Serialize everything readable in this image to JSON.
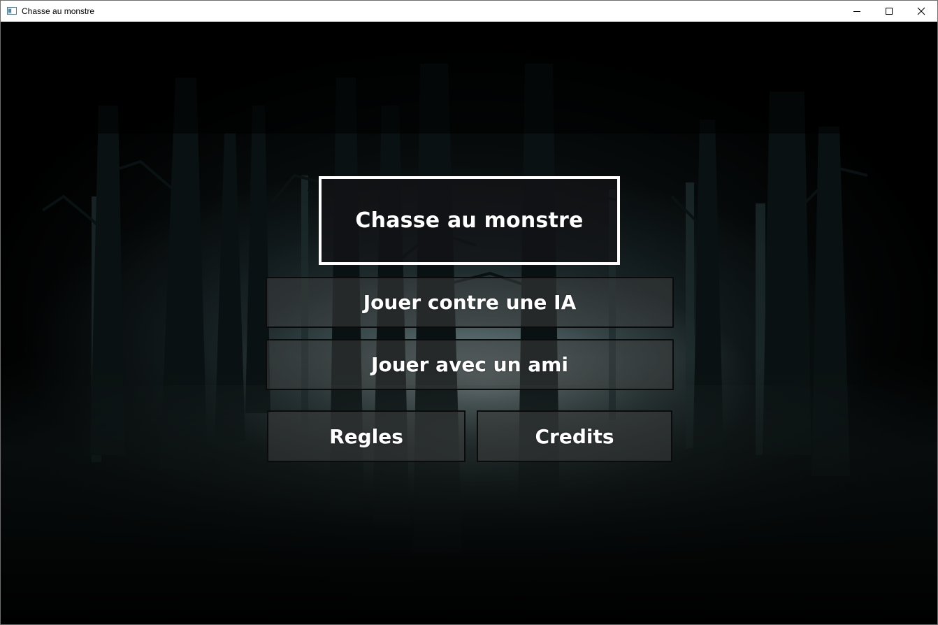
{
  "window": {
    "title": "Chasse au monstre"
  },
  "main": {
    "game_title": "Chasse au monstre",
    "buttons": {
      "play_ai": "Jouer contre une IA",
      "play_friend": "Jouer avec un ami",
      "rules": "Regles",
      "credits": "Credits"
    }
  },
  "icons": {
    "app": "app-window-icon",
    "minimize": "minimize-icon",
    "maximize": "maximize-icon",
    "close": "close-icon"
  }
}
